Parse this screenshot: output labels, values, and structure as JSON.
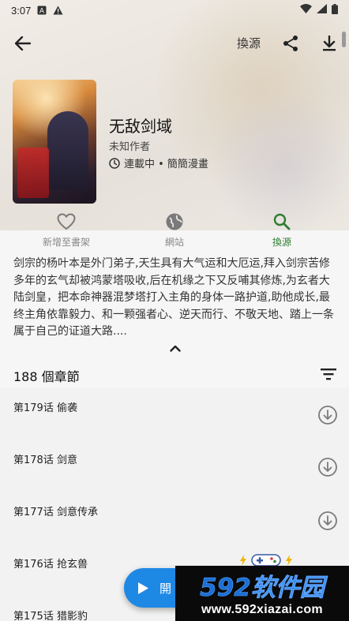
{
  "status_bar": {
    "time": "3:07",
    "icons": [
      "a-notification-icon",
      "warning-icon",
      "wifi-icon",
      "signal-icon",
      "battery-icon"
    ]
  },
  "toolbar": {
    "source_label": "換源",
    "icons": [
      "back-arrow-icon",
      "share-icon",
      "download-icon"
    ]
  },
  "book": {
    "title": "无敌剑域",
    "author": "未知作者",
    "status": "連載中 • 簡簡漫畫"
  },
  "actions": [
    {
      "label": "新增至書架",
      "icon": "heart-icon",
      "active": false
    },
    {
      "label": "網站",
      "icon": "globe-icon",
      "active": false
    },
    {
      "label": "換源",
      "icon": "search-icon",
      "active": true
    }
  ],
  "description": "剑宗的杨叶本是外门弟子,天生具有大气运和大厄运,拜入剑宗苦修多年的玄气却被鸿蒙塔吸收,后在机缘之下又反哺其修炼,为玄者大陆剑皇，把本命神器混梦塔打入主角的身体一路护道,助他成长,最终主角依靠毅力、和一颗强者心、逆天而行、不敬天地、踏上一条属于自己的证道大路....",
  "chapters": {
    "count_label": "188 個章節",
    "items": [
      {
        "title": "第179话 偷袭"
      },
      {
        "title": "第178话 剑意"
      },
      {
        "title": "第177话 剑意传承"
      },
      {
        "title": "第176话 抢玄兽"
      },
      {
        "title": "第175话 猎影豹"
      }
    ]
  },
  "fab": {
    "label": "開"
  },
  "watermark": {
    "logo": "592软件园",
    "url": "www.592xiazai.com"
  },
  "colors": {
    "accent_green": "#2e7d32",
    "fab_blue": "#1e88e5",
    "watermark_blue": "#1b6fd6"
  }
}
